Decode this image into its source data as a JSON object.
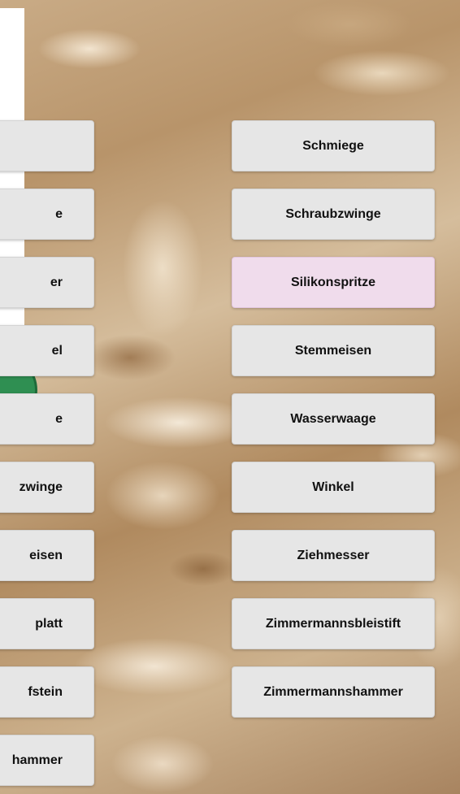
{
  "left_column": [
    {
      "label": ""
    },
    {
      "label": "e"
    },
    {
      "label": "er"
    },
    {
      "label": "el"
    },
    {
      "label": "e"
    },
    {
      "label": "zwinge"
    },
    {
      "label": "eisen"
    },
    {
      "label": "platt"
    },
    {
      "label": "fstein"
    },
    {
      "label": "hammer"
    }
  ],
  "right_column": [
    {
      "label": "Schmiege",
      "selected": false
    },
    {
      "label": "Schraubzwinge",
      "selected": false
    },
    {
      "label": "Silikonspritze",
      "selected": true
    },
    {
      "label": "Stemmeisen",
      "selected": false
    },
    {
      "label": "Wasserwaage",
      "selected": false
    },
    {
      "label": "Winkel",
      "selected": false
    },
    {
      "label": "Ziehmesser",
      "selected": false
    },
    {
      "label": "Zimmermannsbleistift",
      "selected": false
    },
    {
      "label": "Zimmermannshammer",
      "selected": false
    }
  ],
  "colors": {
    "button_bg": "#e6e6e6",
    "selected_bg": "#f0dcec",
    "icon_green": "#2f8f52"
  }
}
